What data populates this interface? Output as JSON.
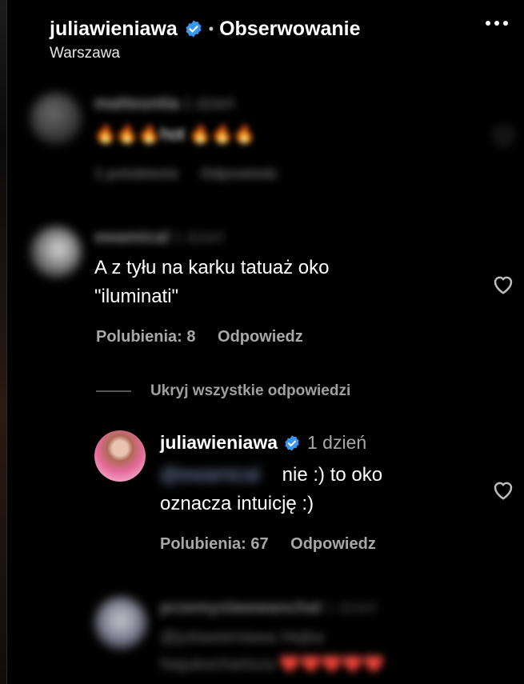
{
  "header": {
    "username": "juliawieniawa",
    "separator": "•",
    "follow_label": "Obserwowanie",
    "location": "Warszawa"
  },
  "comments": [
    {
      "username": "matteuntia",
      "time": "1 dzień",
      "text": "🔥🔥🔥hot 🔥🔥🔥",
      "likes": "1 polubienie",
      "reply_label": "Odpowiedz"
    },
    {
      "username": "ewamical",
      "time": "1 dzień",
      "text_line1": "A z tyłu na karku tatuaż oko",
      "text_line2": "\"iluminati\"",
      "likes": "Polubienia: 8",
      "reply_label": "Odpowiedz"
    }
  ],
  "replies_toggle": "Ukryj wszystkie odpowiedzi",
  "reply": {
    "username": "juliawieniawa",
    "time": "1 dzień",
    "mention": "@ewamical",
    "text_line1": "nie :) to oko",
    "text_line2": "oznacza intuicję :)",
    "likes": "Polubienia: 67",
    "reply_label": "Odpowiedz"
  },
  "reply2": {
    "username": "przemyslawwanchal",
    "time": "1 dzień",
    "text_line1": "@juliawieniawa Hejka",
    "text_line2": "Najukochańsza ❤️❤️❤️❤️❤️"
  }
}
